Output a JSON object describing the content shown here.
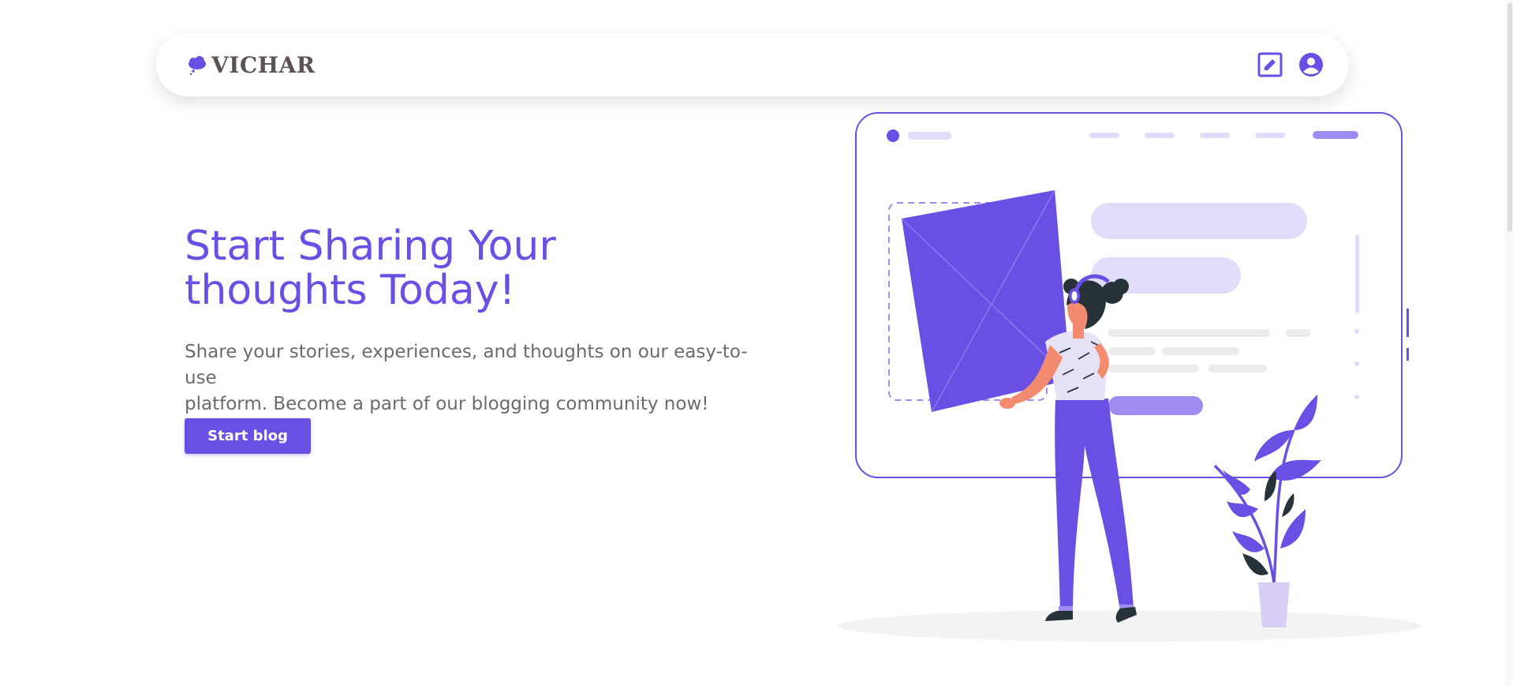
{
  "brand": {
    "name": "VICHAR"
  },
  "nav": {
    "write_icon": "edit-icon",
    "profile_icon": "account-circle-icon"
  },
  "hero": {
    "title_line1": "Start Sharing Your",
    "title_line2": "thoughts Today!",
    "subtitle_line1": "Share your stories, experiences, and thoughts on our easy-to-use",
    "subtitle_line2": "platform. Become a part of our blogging community now!",
    "cta_label": "Start blog"
  },
  "colors": {
    "accent": "#6a4fe4",
    "accent_light": "#e2dcfb",
    "text_muted": "#6b6b6b",
    "brand_text": "#5a5159"
  }
}
